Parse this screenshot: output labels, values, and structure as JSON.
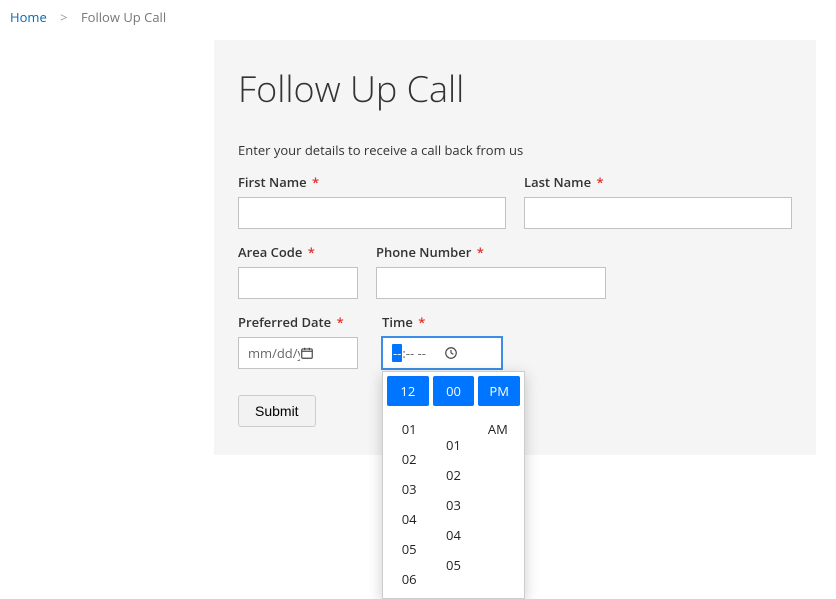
{
  "breadcrumb": {
    "home": "Home",
    "separator": ">",
    "current": "Follow Up Call"
  },
  "page": {
    "title": "Follow Up Call",
    "instruction": "Enter your details to receive a call back from us"
  },
  "labels": {
    "first_name": "First Name",
    "last_name": "Last Name",
    "area_code": "Area Code",
    "phone_number": "Phone Number",
    "preferred_date": "Preferred Date",
    "time": "Time"
  },
  "values": {
    "first_name": "",
    "last_name": "",
    "area_code": "",
    "phone_number": "",
    "preferred_date_placeholder": "mm/dd/yyyy",
    "time_placeholder_seg1": "--",
    "time_placeholder_seg2": ":-- --"
  },
  "time_picker": {
    "header_hour": "12",
    "header_minute": "00",
    "header_period_sel": "PM",
    "period_other": "AM",
    "hours": [
      "01",
      "02",
      "03",
      "04",
      "05",
      "06"
    ],
    "minutes": [
      "01",
      "02",
      "03",
      "04",
      "05"
    ]
  },
  "buttons": {
    "submit": "Submit"
  }
}
